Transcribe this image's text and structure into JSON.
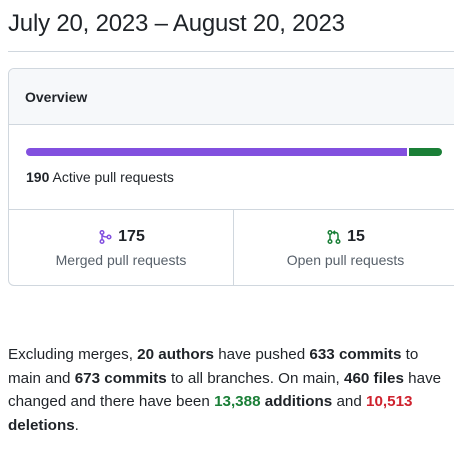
{
  "period": {
    "date_range": "July 20, 2023 – August 20, 2023"
  },
  "overview": {
    "title": "Overview",
    "progress": {
      "merged_fraction": 0.921,
      "open_fraction": 0.079,
      "colors": {
        "merged": "#8250df",
        "open": "#1a7f37"
      }
    },
    "active_count": "190",
    "active_label": "Active pull requests",
    "merged": {
      "icon": "git-merge-icon",
      "count": "175",
      "label": "Merged pull requests",
      "color": "#8250df"
    },
    "open": {
      "icon": "git-pull-request-icon",
      "count": "15",
      "label": "Open pull requests",
      "color": "#1a7f37"
    }
  },
  "summary": {
    "p1": "Excluding merges, ",
    "authors": "20 authors",
    "p2": " have pushed ",
    "commits_main": "633 commits",
    "p3": " to main and ",
    "commits_all": "673 commits",
    "p4": " to all branches. On main, ",
    "files": "460 files",
    "p5": " have changed and there have been ",
    "additions_count": "13,388",
    "additions_word": "additions",
    "p6": " and ",
    "deletions_count": "10,513",
    "deletions_word": "deletions",
    "p7": ".",
    "colors": {
      "additions": "#1a7f37",
      "deletions": "#cf222e"
    }
  }
}
